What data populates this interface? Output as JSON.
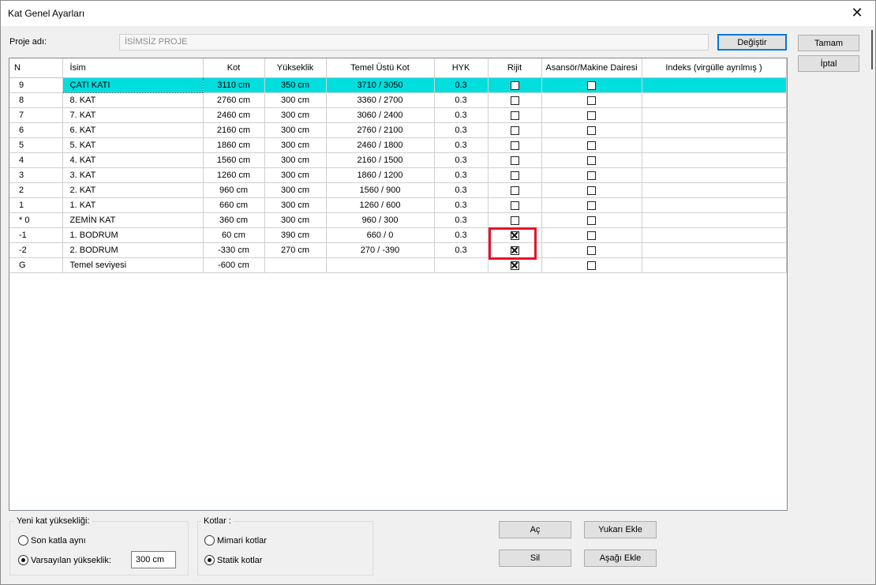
{
  "window": {
    "title": "Kat Genel Ayarları"
  },
  "project": {
    "label": "Proje adı:",
    "value": "İSİMSİZ PROJE",
    "change_button": "Değiştir"
  },
  "actions": {
    "ok": "Tamam",
    "cancel": "İptal"
  },
  "table": {
    "columns": [
      "N",
      "İsim",
      "Kot",
      "Yükseklik",
      "Temel Üstü Kot",
      "HYK",
      "Rijit",
      "Asansör/Makine Dairesi",
      "Indeks (virgülle ayrılmış )"
    ],
    "rows": [
      {
        "n": "9",
        "name": "ÇATI KATI",
        "kot": "3110 cm",
        "height": "350 cm",
        "temel": "3710 / 3050",
        "hyk": "0.3",
        "rijit": false,
        "elevator": false,
        "selected": true
      },
      {
        "n": "8",
        "name": "8. KAT",
        "kot": "2760 cm",
        "height": "300 cm",
        "temel": "3360 / 2700",
        "hyk": "0.3",
        "rijit": false,
        "elevator": false
      },
      {
        "n": "7",
        "name": "7. KAT",
        "kot": "2460 cm",
        "height": "300 cm",
        "temel": "3060 / 2400",
        "hyk": "0.3",
        "rijit": false,
        "elevator": false
      },
      {
        "n": "6",
        "name": "6. KAT",
        "kot": "2160 cm",
        "height": "300 cm",
        "temel": "2760 / 2100",
        "hyk": "0.3",
        "rijit": false,
        "elevator": false
      },
      {
        "n": "5",
        "name": "5. KAT",
        "kot": "1860 cm",
        "height": "300 cm",
        "temel": "2460 / 1800",
        "hyk": "0.3",
        "rijit": false,
        "elevator": false
      },
      {
        "n": "4",
        "name": "4. KAT",
        "kot": "1560 cm",
        "height": "300 cm",
        "temel": "2160 / 1500",
        "hyk": "0.3",
        "rijit": false,
        "elevator": false
      },
      {
        "n": "3",
        "name": "3. KAT",
        "kot": "1260 cm",
        "height": "300 cm",
        "temel": "1860 / 1200",
        "hyk": "0.3",
        "rijit": false,
        "elevator": false
      },
      {
        "n": "2",
        "name": "2. KAT",
        "kot": "960 cm",
        "height": "300 cm",
        "temel": "1560 / 900",
        "hyk": "0.3",
        "rijit": false,
        "elevator": false
      },
      {
        "n": "1",
        "name": "1. KAT",
        "kot": "660 cm",
        "height": "300 cm",
        "temel": "1260 / 600",
        "hyk": "0.3",
        "rijit": false,
        "elevator": false
      },
      {
        "n": "* 0",
        "name": "ZEMİN KAT",
        "kot": "360 cm",
        "height": "300 cm",
        "temel": "960 / 300",
        "hyk": "0.3",
        "rijit": false,
        "elevator": false
      },
      {
        "n": "-1",
        "name": "1. BODRUM",
        "kot": "60 cm",
        "height": "390 cm",
        "temel": "660 / 0",
        "hyk": "0.3",
        "rijit": true,
        "elevator": false
      },
      {
        "n": "-2",
        "name": "2. BODRUM",
        "kot": "-330 cm",
        "height": "270 cm",
        "temel": "270 / -390",
        "hyk": "0.3",
        "rijit": true,
        "elevator": false
      },
      {
        "n": "G",
        "name": "Temel seviyesi",
        "kot": "-600 cm",
        "height": "",
        "temel": "",
        "hyk": "",
        "rijit": true,
        "elevator": false
      }
    ]
  },
  "new_floor": {
    "group_label": "Yeni kat yüksekliği:",
    "option_same": "Son katla aynı",
    "option_default": "Varsayılan yükseklik:",
    "default_value": "300 cm",
    "selected": "default"
  },
  "levels": {
    "group_label": "Kotlar :",
    "option_arch": "Mimari kotlar",
    "option_static": "Statik kotlar",
    "selected": "static"
  },
  "buttons": {
    "open": "Aç",
    "delete": "Sil",
    "add_above": "Yukarı Ekle",
    "add_below": "Aşağı Ekle"
  },
  "highlight": {
    "color": "#e8102a"
  },
  "colors": {
    "selected_row": "#00dede",
    "focus_border": "#0078d7"
  }
}
